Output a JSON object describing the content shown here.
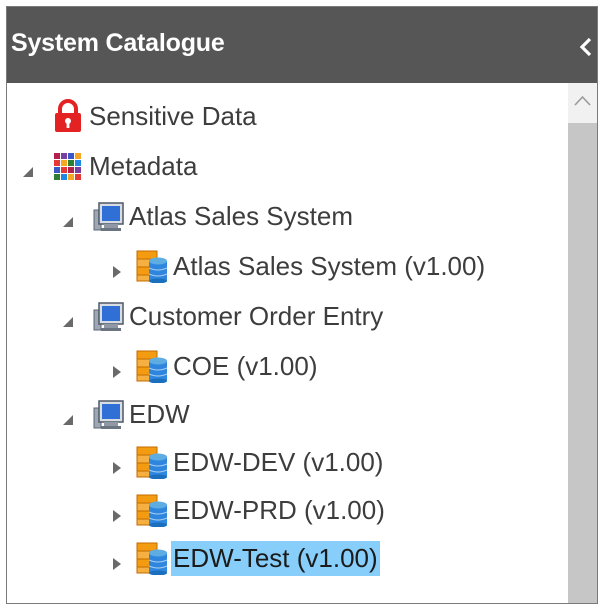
{
  "panel": {
    "title": "System Catalogue"
  },
  "tree": {
    "sensitive": "Sensitive Data",
    "metadata": "Metadata",
    "atlas_system": "Atlas Sales System",
    "atlas_model": "Atlas Sales System (v1.00)",
    "coe_system": "Customer Order Entry",
    "coe_model": "COE (v1.00)",
    "edw_system": "EDW",
    "edw_dev": "EDW-DEV (v1.00)",
    "edw_prd": "EDW-PRD (v1.00)",
    "edw_test": "EDW-Test (v1.00)",
    "selected": "EDW-Test (v1.00)"
  },
  "colors": {
    "header_bg": "#565656",
    "selection": "#87cefa",
    "scrollbar_track": "#c6c6c6"
  }
}
